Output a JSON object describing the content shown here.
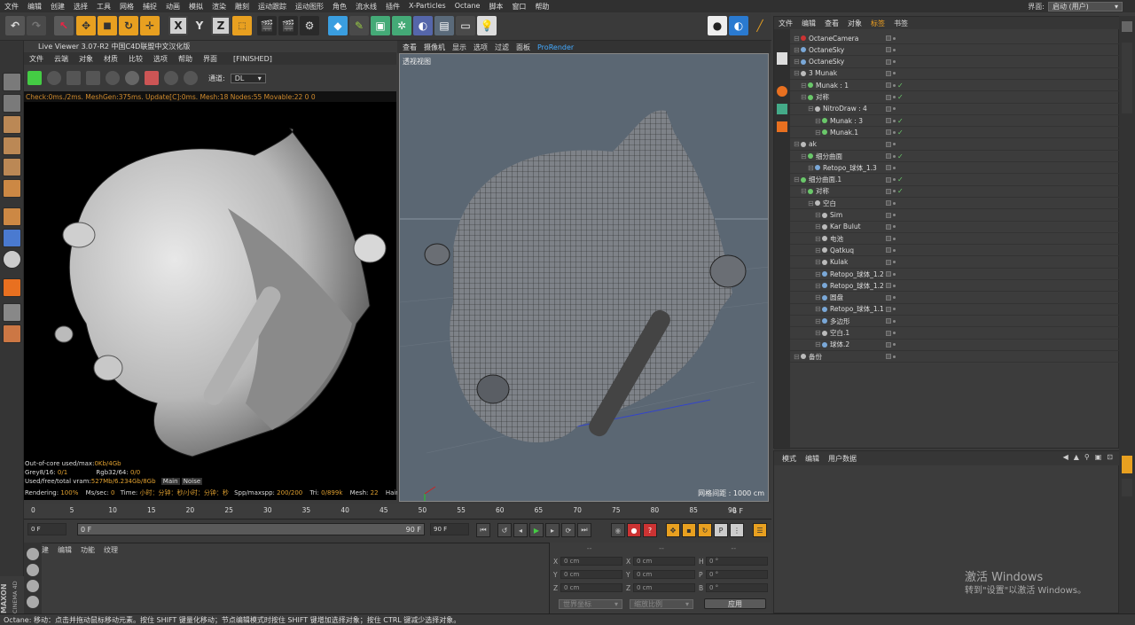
{
  "menubar": {
    "items": [
      "文件",
      "编辑",
      "创建",
      "选择",
      "工具",
      "网格",
      "捕捉",
      "动画",
      "模拟",
      "渲染",
      "雕刻",
      "运动跟踪",
      "运动图形",
      "角色",
      "流水线",
      "插件",
      "X-Particles",
      "Octane",
      "脚本",
      "窗口",
      "帮助"
    ],
    "layout_label": "界面:",
    "layout_value": "启动 (用户)"
  },
  "live_viewer": {
    "title": "Live Viewer 3.07-R2 中国C4D联盟中文汉化版",
    "menu": [
      "文件",
      "云端",
      "对象",
      "材质",
      "比较",
      "选项",
      "帮助",
      "界面"
    ],
    "status": "[FINISHED]",
    "channel_label": "通道:",
    "channel_value": "DL",
    "stats": "Check:0ms./2ms. MeshGen:375ms. Update[C]:0ms. Mesh:18 Nodes:55 Movable:22  0 0",
    "info": {
      "ooc_label": "Out-of-core used/max:",
      "ooc_value": "0Kb/4Gb",
      "grey_label": "Grey8/16:",
      "grey_value": "0/1",
      "rgb_label": "Rgb32/64:",
      "rgb_value": "0/0",
      "vram_label": "Used/free/total vram:",
      "vram_value": "527Mb/6.234Gb/8Gb",
      "tab_main": "Main",
      "tab_noise": "Noise",
      "rendering_label": "Rendering:",
      "rendering_value": "100%",
      "mssec_label": "Ms/sec:",
      "mssec_value": "0",
      "time_label": "Time:",
      "time_value": "小时：分钟：秒/小时：分钟：秒",
      "spp_label": "Spp/maxspp:",
      "spp_value": "200/200",
      "tri_label": "Tri:",
      "tri_value": "0/899k",
      "mesh_label": "Mesh:",
      "mesh_value": "22",
      "hair_label": "Hair:",
      "hair_value": "0",
      "gp_label": "GP"
    }
  },
  "viewport": {
    "menu": [
      "查看",
      "摄像机",
      "显示",
      "选项",
      "过滤",
      "面板"
    ],
    "prorender": "ProRender",
    "view_name": "透视视图",
    "grid_spacing": "网格间距 : 1000 cm",
    "bg_color": "#5b6773"
  },
  "timeline": {
    "ticks": [
      "0",
      "5",
      "10",
      "15",
      "20",
      "25",
      "30",
      "35",
      "40",
      "45",
      "50",
      "55",
      "60",
      "65",
      "70",
      "75",
      "80",
      "85",
      "90"
    ],
    "end_field": "-6 F",
    "start_frame": "0 F",
    "range_start": "0 F",
    "range_end": "90 F",
    "end_frame": "90 F"
  },
  "material_manager": {
    "menu": [
      "创建",
      "编辑",
      "功能",
      "纹理"
    ]
  },
  "coordinates": {
    "header": [
      "--",
      "--",
      "--"
    ],
    "rows": [
      {
        "a": "X",
        "av": "0 cm",
        "b": "X",
        "bv": "0 cm",
        "c": "H",
        "cv": "0 °"
      },
      {
        "a": "Y",
        "av": "0 cm",
        "b": "Y",
        "bv": "0 cm",
        "c": "P",
        "cv": "0 °"
      },
      {
        "a": "Z",
        "av": "0 cm",
        "b": "Z",
        "bv": "0 cm",
        "c": "B",
        "cv": "0 °"
      }
    ],
    "world": "世界坐标",
    "scale": "缩放比例",
    "apply": "应用"
  },
  "object_manager": {
    "tabs": [
      "文件",
      "编辑",
      "查看",
      "对象",
      "标签",
      "书签"
    ],
    "active_tab": "标签",
    "objects": [
      {
        "name": "OctaneCamera",
        "indent": 0,
        "icon": "camera",
        "check": false
      },
      {
        "name": "OctaneSky",
        "indent": 0,
        "icon": "sky",
        "check": false
      },
      {
        "name": "OctaneSky",
        "indent": 0,
        "icon": "sky",
        "check": false
      },
      {
        "name": "3 Munak",
        "indent": 0,
        "icon": "null",
        "check": false
      },
      {
        "name": "Munak : 1",
        "indent": 1,
        "icon": "gen",
        "check": true
      },
      {
        "name": "对称",
        "indent": 1,
        "icon": "gen",
        "check": true
      },
      {
        "name": "NitroDraw : 4",
        "indent": 2,
        "icon": "null",
        "check": false
      },
      {
        "name": "Munak : 3",
        "indent": 3,
        "icon": "gen",
        "check": true
      },
      {
        "name": "Munak.1",
        "indent": 3,
        "icon": "gen",
        "check": true
      },
      {
        "name": "ak",
        "indent": 0,
        "icon": "null",
        "check": false
      },
      {
        "name": "细分曲面",
        "indent": 1,
        "icon": "gen",
        "check": true
      },
      {
        "name": "Retopo_球体_1.3",
        "indent": 2,
        "icon": "poly",
        "check": false
      },
      {
        "name": "细分曲面.1",
        "indent": 0,
        "icon": "gen",
        "check": true
      },
      {
        "name": "对称",
        "indent": 1,
        "icon": "gen",
        "check": true
      },
      {
        "name": "空白",
        "indent": 2,
        "icon": "null",
        "check": false
      },
      {
        "name": "Sim",
        "indent": 3,
        "icon": "null",
        "check": false
      },
      {
        "name": "Kar Bulut",
        "indent": 3,
        "icon": "null",
        "check": false
      },
      {
        "name": "电池",
        "indent": 3,
        "icon": "null",
        "check": false
      },
      {
        "name": "Qatkuq",
        "indent": 3,
        "icon": "null",
        "check": false
      },
      {
        "name": "Kulak",
        "indent": 3,
        "icon": "null",
        "check": false
      },
      {
        "name": "Retopo_球体_1.2",
        "indent": 3,
        "icon": "poly",
        "check": false
      },
      {
        "name": "Retopo_球体_1.2",
        "indent": 3,
        "icon": "poly",
        "check": false
      },
      {
        "name": "圆盘",
        "indent": 3,
        "icon": "poly",
        "check": false
      },
      {
        "name": "Retopo_球体_1.1",
        "indent": 3,
        "icon": "poly",
        "check": false
      },
      {
        "name": "多边形",
        "indent": 3,
        "icon": "poly",
        "check": false
      },
      {
        "name": "空白.1",
        "indent": 3,
        "icon": "null",
        "check": false
      },
      {
        "name": "球体.2",
        "indent": 3,
        "icon": "poly",
        "check": false
      },
      {
        "name": "备份",
        "indent": 0,
        "icon": "null",
        "check": false
      }
    ]
  },
  "attribute_manager": {
    "tabs": [
      "模式",
      "编辑",
      "用户数据"
    ]
  },
  "status_bar": {
    "text": "Octane:        移动：点击并拖动鼠标移动元素。按住 SHIFT 键量化移动；节点编辑模式时按住 SHIFT 键增加选择对象；按住 CTRL 键减少选择对象。"
  },
  "watermark": {
    "line1": "激活 Windows",
    "line2": "转到\"设置\"以激活 Windows。"
  },
  "brand": {
    "maxon": "MAXON",
    "cinema": "CINEMA 4D"
  },
  "colors": {
    "accent": "#f0a020",
    "check": "#6ac86a"
  }
}
